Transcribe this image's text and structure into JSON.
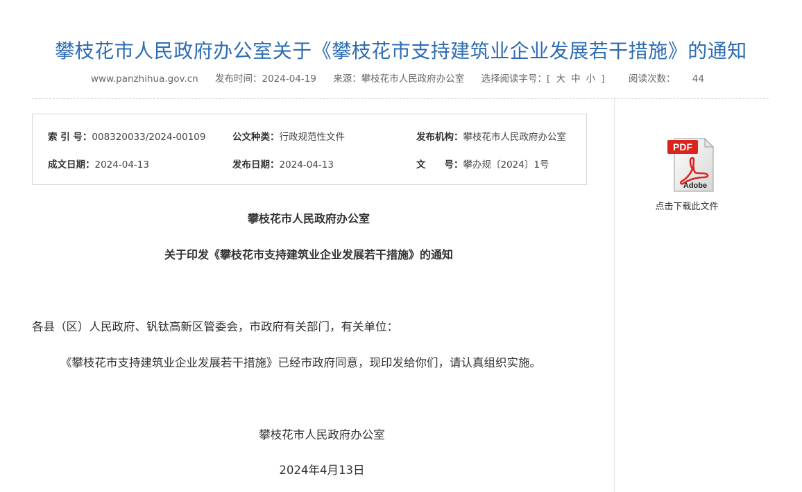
{
  "header": {
    "title": "攀枝花市人民政府办公室关于《攀枝花市支持建筑业企业发展若干措施》的通知"
  },
  "meta": {
    "site": "www.panzhihua.gov.cn",
    "publish_time": "发布时间：2024-04-19",
    "source": "来源：攀枝花市人民政府办公室",
    "font_size_label": "选择阅读字号：",
    "font_sizes": [
      "大",
      "中",
      "小"
    ],
    "bracket_open": "[",
    "bracket_close": "]",
    "views_label": "阅读次数：",
    "views": "44"
  },
  "info": {
    "index_label": "索 引 号：",
    "index_value": "008320033/2024-00109",
    "doc_type_label": "公文种类：",
    "doc_type_value": "行政规范性文件",
    "issuer_label": "发布机构：",
    "issuer_value": "攀枝花市人民政府办公室",
    "written_label": "成文日期：",
    "written_value": "2024-04-13",
    "pub_label": "发布日期：",
    "pub_value": "2024-04-13",
    "docno_label": "文　　号：",
    "docno_value": "攀办规〔2024〕1号"
  },
  "download": {
    "label": "点击下载此文件",
    "pdf_tag": "PDF",
    "adobe_tag": "Adobe"
  },
  "body": {
    "heading1": "攀枝花市人民政府办公室",
    "heading2": "关于印发《攀枝花市支持建筑业企业发展若干措施》的通知",
    "para1": "各县（区）人民政府、钒钛高新区管委会，市政府有关部门，有关单位：",
    "para2": "《攀枝花市支持建筑业企业发展若干措施》已经市政府同意，现印发给你们，请认真组织实施。",
    "sign_org": "攀枝花市人民政府办公室",
    "sign_date": "2024年4月13日"
  },
  "colors": {
    "title": "#2e6db3",
    "pdf_red": "#d9251d"
  }
}
